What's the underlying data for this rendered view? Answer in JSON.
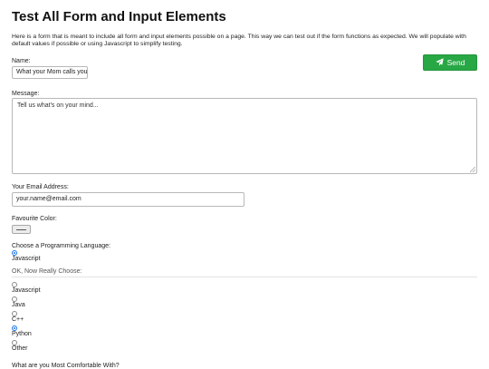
{
  "page": {
    "title": "Test All Form and Input Elements",
    "intro": "Here is a form that is meant to include all form and input elements possible on a page. This way we can test out if the form functions as expected. We will populate with default values if possible or using Javascript to simplify testing."
  },
  "form": {
    "name_label": "Name:",
    "name_value": "What your Mom calls you",
    "send_label": "Send",
    "message_label": "Message:",
    "message_placeholder": "Tell us what's on your mind...",
    "email_label": "Your Email Address:",
    "email_value": "your.name@email.com",
    "color_label": "Favourite Color:",
    "language_label": "Choose a Programming Language:",
    "language_options": [
      "Javascript"
    ],
    "really_choose_label": "OK, Now Really Choose:",
    "really_choose_options": [
      "Javascript",
      "Java",
      "C++",
      "Python",
      "Other"
    ],
    "really_choose_selected": "Python",
    "comfortable_label": "What are you Most Comfortable With?"
  },
  "colors": {
    "send_button": "#28a745",
    "radio_selected": "#1a73e8"
  },
  "icons": {
    "send": "paper-plane-icon"
  }
}
